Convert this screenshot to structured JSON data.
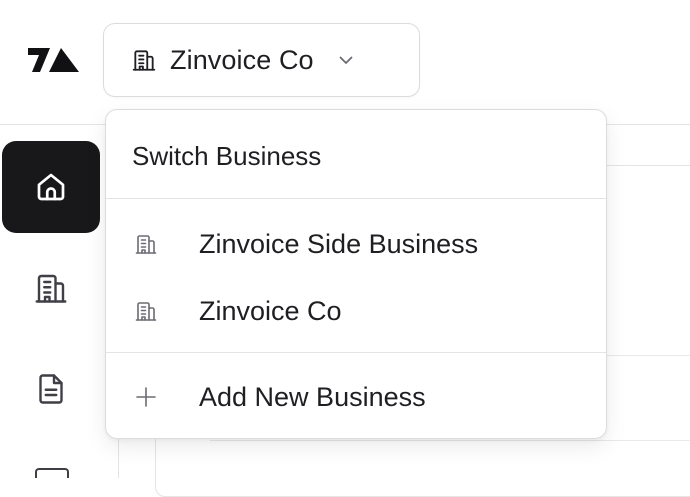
{
  "header": {
    "logo_icon": "zinvoice-logo-icon",
    "current_business": "Zinvoice Co",
    "switcher_icon": "building-icon",
    "chevron_icon": "chevron-down-icon"
  },
  "sidebar": {
    "items": [
      {
        "icon": "home-icon",
        "active": true
      },
      {
        "icon": "building-icon",
        "active": false
      },
      {
        "icon": "document-icon",
        "active": false
      }
    ]
  },
  "menu": {
    "heading": "Switch Business",
    "businesses": [
      {
        "label": "Zinvoice Side Business",
        "icon": "building-icon"
      },
      {
        "label": "Zinvoice Co",
        "icon": "building-icon"
      }
    ],
    "add_label": "Add New Business",
    "add_icon": "plus-icon"
  },
  "colors": {
    "active_nav_bg": "#18181b",
    "border": "#dcdce0",
    "text": "#1f1f23",
    "icon_muted": "#6b6b73"
  }
}
